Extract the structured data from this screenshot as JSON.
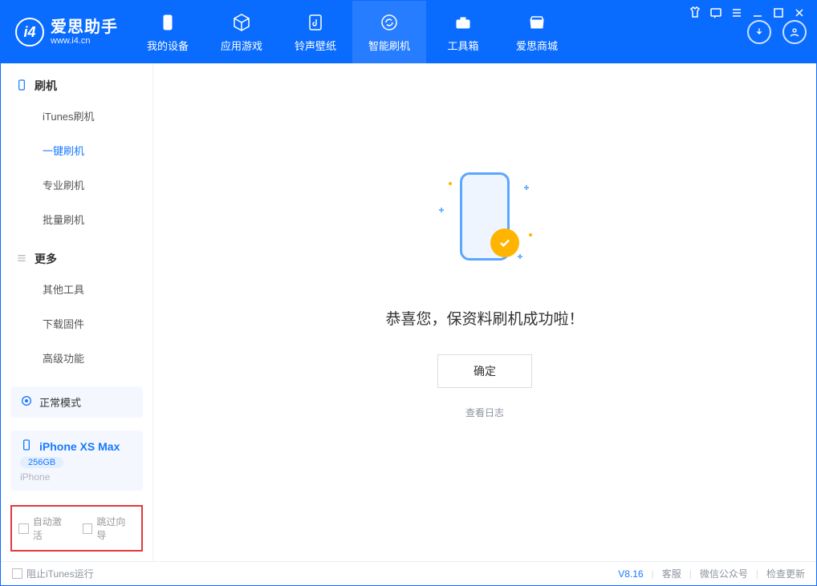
{
  "app": {
    "title": "爱思助手",
    "subtitle": "www.i4.cn"
  },
  "nav": {
    "items": [
      {
        "label": "我的设备"
      },
      {
        "label": "应用游戏"
      },
      {
        "label": "铃声壁纸"
      },
      {
        "label": "智能刷机"
      },
      {
        "label": "工具箱"
      },
      {
        "label": "爱思商城"
      }
    ]
  },
  "sidebar": {
    "section1_title": "刷机",
    "section1_items": [
      {
        "label": "iTunes刷机"
      },
      {
        "label": "一键刷机"
      },
      {
        "label": "专业刷机"
      },
      {
        "label": "批量刷机"
      }
    ],
    "section2_title": "更多",
    "section2_items": [
      {
        "label": "其他工具"
      },
      {
        "label": "下载固件"
      },
      {
        "label": "高级功能"
      }
    ]
  },
  "mode_card": {
    "label": "正常模式"
  },
  "device": {
    "name": "iPhone XS Max",
    "storage": "256GB",
    "type": "iPhone"
  },
  "options": {
    "auto_activate": "自动激活",
    "skip_guide": "跳过向导"
  },
  "main": {
    "success_message": "恭喜您，保资料刷机成功啦！",
    "ok_button": "确定",
    "log_link": "查看日志"
  },
  "footer": {
    "block_itunes": "阻止iTunes运行",
    "version": "V8.16",
    "support": "客服",
    "wechat": "微信公众号",
    "check_update": "检查更新"
  }
}
